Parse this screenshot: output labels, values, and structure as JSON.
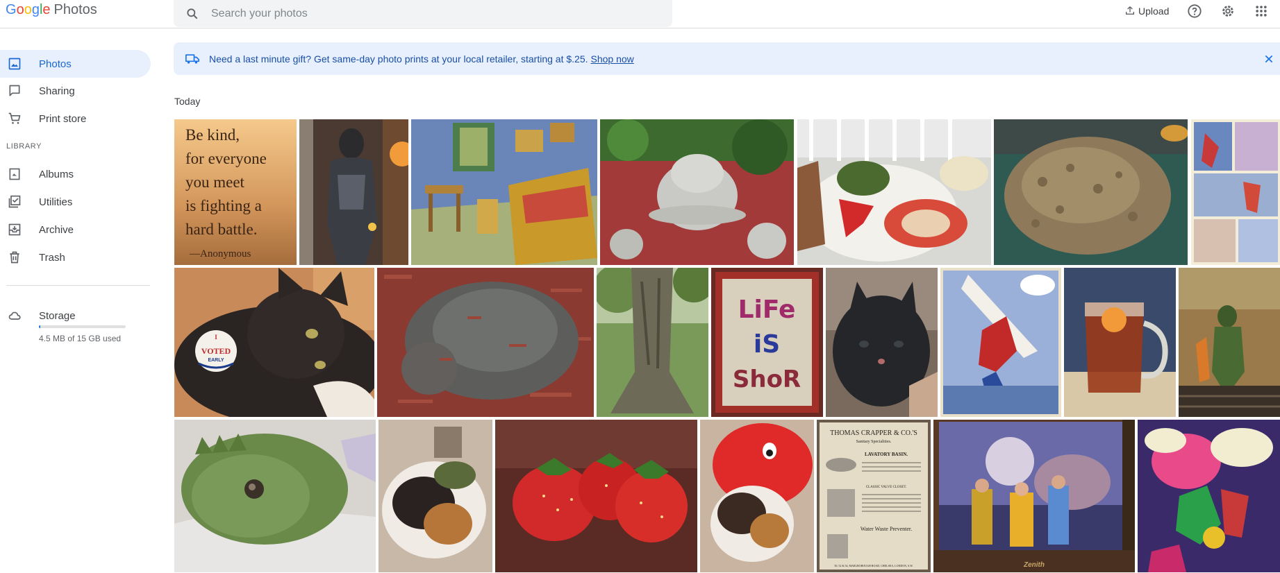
{
  "header": {
    "logo": {
      "letters": [
        "G",
        "o",
        "o",
        "g",
        "l",
        "e"
      ],
      "product": "Photos"
    },
    "search": {
      "placeholder": "Search your photos"
    },
    "upload_label": "Upload"
  },
  "sidebar": {
    "items": [
      {
        "label": "Photos",
        "icon": "photo-icon",
        "active": true
      },
      {
        "label": "Sharing",
        "icon": "chat-bubble-icon",
        "active": false
      },
      {
        "label": "Print store",
        "icon": "cart-icon",
        "active": false
      }
    ],
    "library_label": "LIBRARY",
    "library_items": [
      {
        "label": "Albums",
        "icon": "bookmark-icon"
      },
      {
        "label": "Utilities",
        "icon": "checklist-icon"
      },
      {
        "label": "Archive",
        "icon": "archive-icon"
      },
      {
        "label": "Trash",
        "icon": "trash-icon"
      }
    ],
    "storage": {
      "label": "Storage",
      "used_text": "4.5 MB of 15 GB used",
      "used_fraction": 0.0003
    }
  },
  "banner": {
    "text": "Need a last minute gift? Get same-day photo prints at your local retailer, starting at $.25.",
    "link": "Shop now"
  },
  "day_label": "Today",
  "photos": {
    "quote": {
      "lines": [
        "Be kind,",
        "for everyone",
        "you meet",
        "is fighting a",
        "hard battle."
      ],
      "attribution": "—Anonymous"
    },
    "voted_sticker": {
      "top": "I",
      "main": "VOTED",
      "bottom": "EARLY"
    },
    "life_is_short": [
      "LiFe",
      "iS",
      "ShoR"
    ],
    "crapper_ad": {
      "title": "THOMAS CRAPPER & CO.'S",
      "subtitle": "Sanitary Specialities.",
      "heading": "LAVATORY BASIN.",
      "sub_heading": "CLASSIC VALVE CLOSET.",
      "bottom_heading": "Water Waste Preventer.",
      "footer": "50, 52 & 54, MARLBOROUGH ROAD, CHELSEA, LONDON, S.W."
    },
    "zenith": "Zenith"
  },
  "colors": {
    "accent": "#1a73e8",
    "active_bg": "#e8f0fe",
    "banner_text": "#174ea6"
  }
}
